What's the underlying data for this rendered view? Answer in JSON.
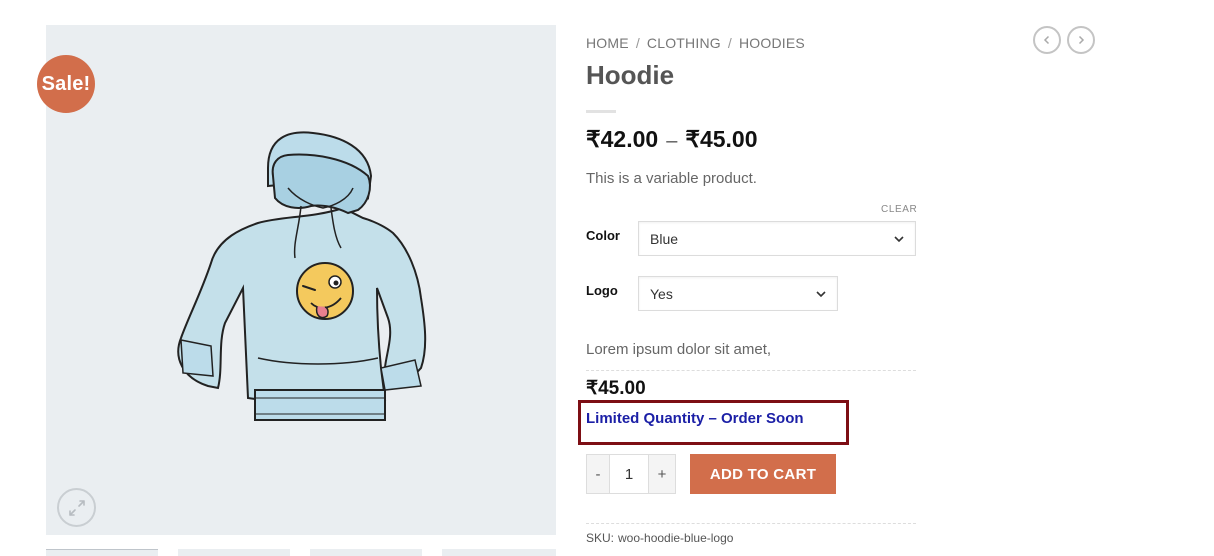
{
  "badge": {
    "sale": "Sale!"
  },
  "breadcrumb": {
    "home": "HOME",
    "sep": "/",
    "clothing": "CLOTHING",
    "hoodies": "HOODIES"
  },
  "product": {
    "title": "Hoodie",
    "price_min": "₹42.00",
    "price_sep": "–",
    "price_max": "₹45.00",
    "short_description": "This is a variable product.",
    "variation_description": "Lorem ipsum dolor sit amet,",
    "variation_price": "₹45.00",
    "stock_message": "Limited Quantity – Order Soon",
    "sku_label": "SKU:",
    "sku_value": "woo-hoodie-blue-logo"
  },
  "variations": {
    "clear_label": "CLEAR",
    "color": {
      "label": "Color",
      "selected": "Blue"
    },
    "logo": {
      "label": "Logo",
      "selected": "Yes"
    }
  },
  "cart": {
    "minus": "-",
    "quantity": "1",
    "plus": "+",
    "add_label": "ADD TO CART"
  },
  "icons": {
    "zoom": "expand-arrows-icon",
    "prev": "chevron-left-icon",
    "next": "chevron-right-icon",
    "dropdown": "chevron-down-icon"
  },
  "colors": {
    "accent": "#d26e4b",
    "stock_text": "#1b1fa6",
    "highlight_border": "#7d0e14",
    "gallery_bg": "#eaeef1"
  }
}
